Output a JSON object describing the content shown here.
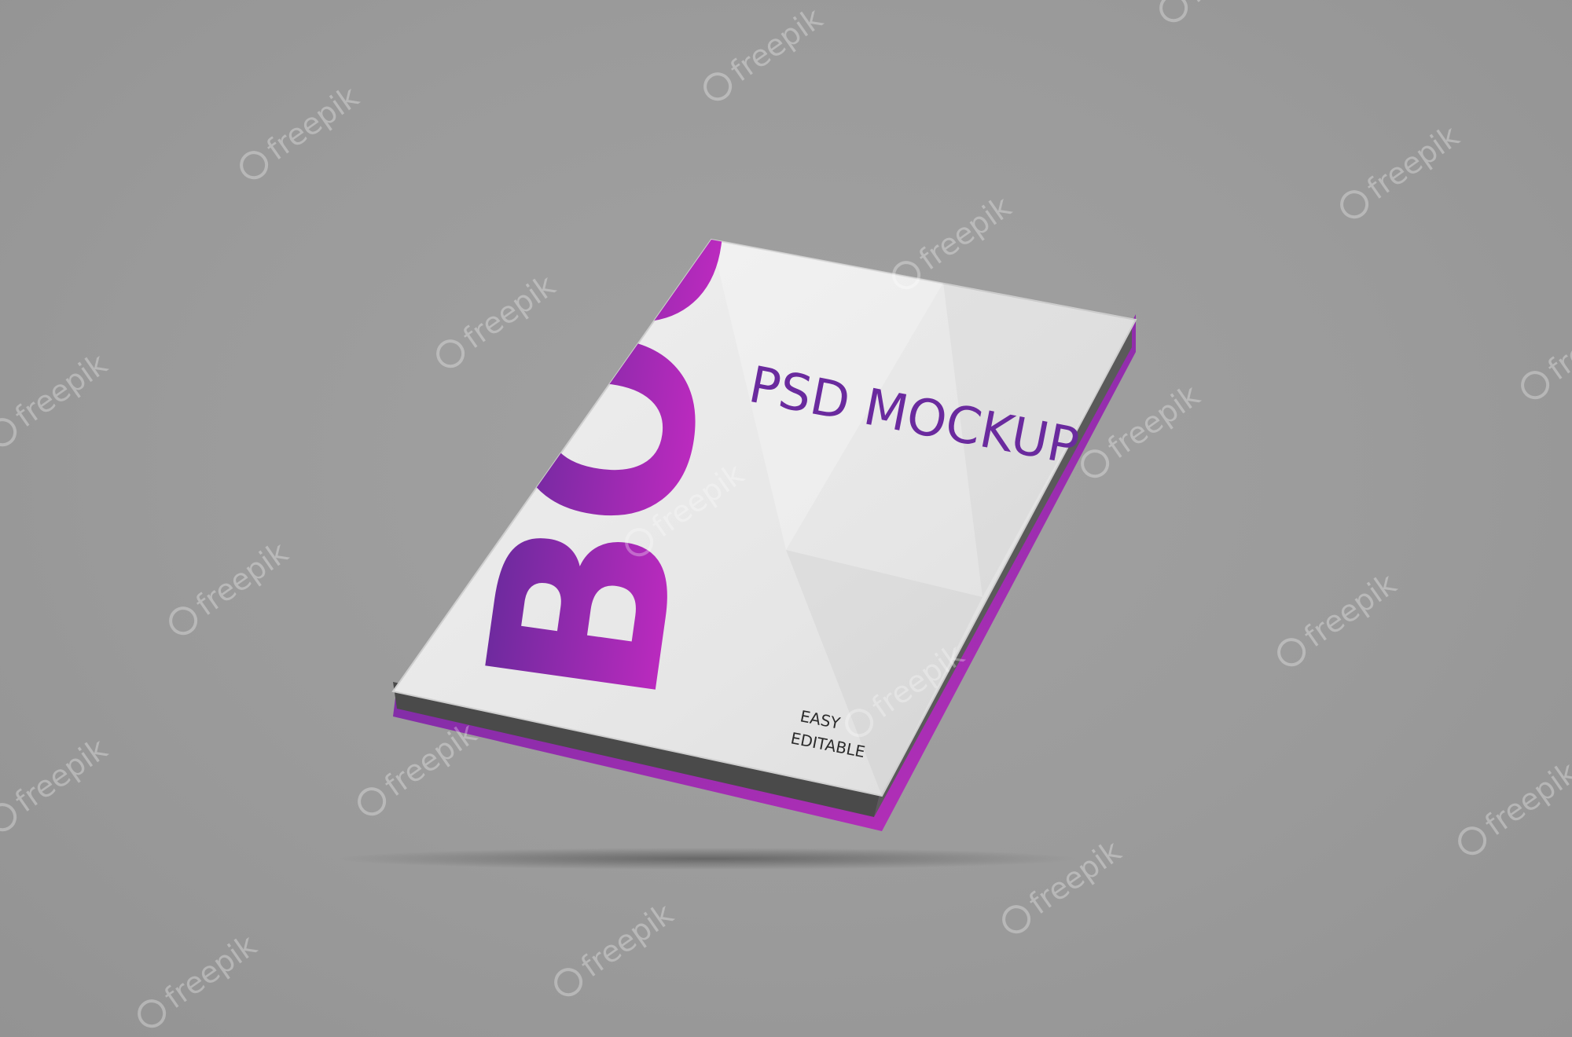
{
  "cover": {
    "title": "BOOK",
    "subtitle": "PSD MOCKUP",
    "tagline_line1": "EASY",
    "tagline_line2": "EDITABLE"
  },
  "watermark": {
    "text": "freepik"
  },
  "colors": {
    "background": "#999999",
    "cover": "#e8e8e8",
    "title_top": "#5a2a96",
    "title_bottom": "#d22ac8",
    "subtitle": "#6a2a9e",
    "spine": "#b62fb0",
    "pages": "#4a4a4a"
  }
}
